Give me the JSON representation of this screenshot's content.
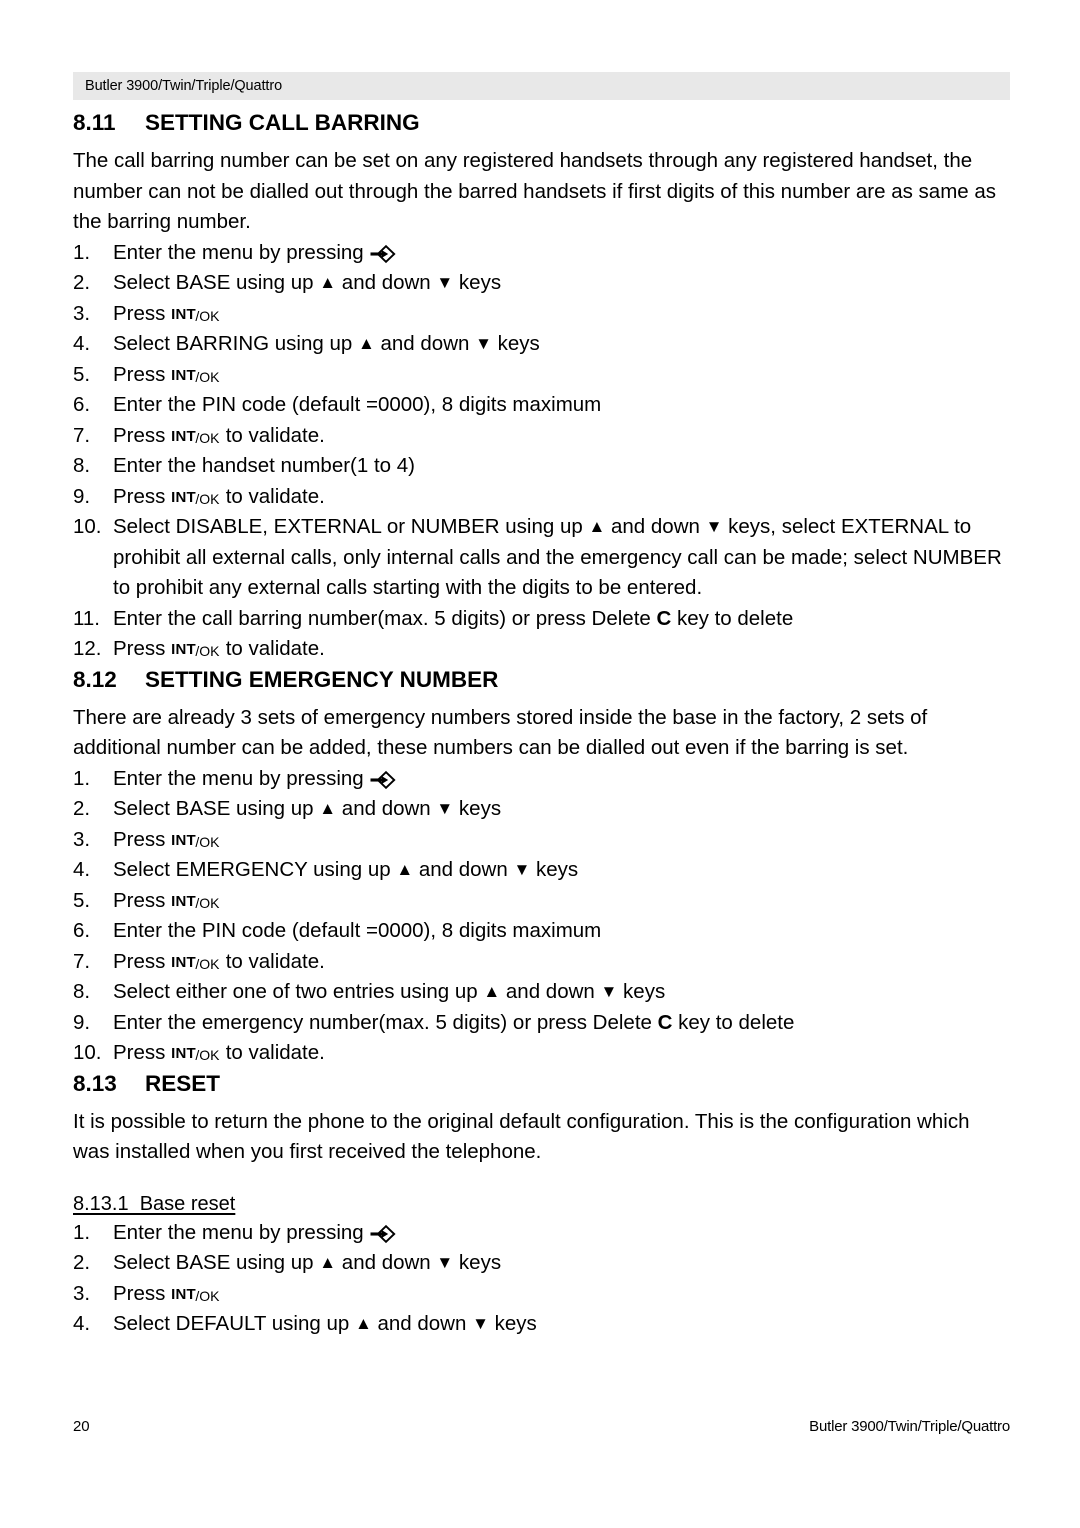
{
  "header": {
    "running_head": "Butler 3900/Twin/Triple/Quattro"
  },
  "icons": {
    "menu_key": "menu-arrow-diamond-icon",
    "up_key": "▲",
    "down_key": "▼",
    "int_ok_key_bold": "INT",
    "int_ok_key_small": "/OK",
    "delete_key": "C"
  },
  "sections": [
    {
      "number": "8.11",
      "title": "SETTING CALL BARRING",
      "paragraph": "The call barring number can be set on any registered handsets through any registered handset, the number can not be dialled out through the barred handsets if first digits of this number are as same as the barring number.",
      "steps": [
        {
          "mark": "1.",
          "pre": "Enter the menu by pressing ",
          "post": "",
          "glyph": "menu"
        },
        {
          "mark": "2.",
          "pre": "Select BASE using up ",
          "mid": " and down ",
          "post": " keys",
          "glyph": "updown"
        },
        {
          "mark": "3.",
          "pre": "Press ",
          "post": "",
          "glyph": "intok"
        },
        {
          "mark": "4.",
          "pre": "Select BARRING using up ",
          "mid": " and down ",
          "post": " keys",
          "glyph": "updown"
        },
        {
          "mark": "5.",
          "pre": "Press ",
          "post": "",
          "glyph": "intok"
        },
        {
          "mark": "6.",
          "pre": "Enter the PIN code (default =0000), 8 digits maximum",
          "post": "",
          "glyph": "none"
        },
        {
          "mark": "7.",
          "pre": "Press ",
          "post": " to validate.",
          "glyph": "intok"
        },
        {
          "mark": "8.",
          "pre": "Enter the handset number(1 to 4)",
          "post": "",
          "glyph": "none"
        },
        {
          "mark": "9.",
          "pre": "Press ",
          "post": " to validate.",
          "glyph": "intok"
        },
        {
          "mark": "10.",
          "pre": "Select DISABLE, EXTERNAL or NUMBER using up ",
          "mid": " and down ",
          "post": " keys, select EXTERNAL to prohibit all external calls, only internal calls and the emergency call can be made; select NUMBER to prohibit any external calls starting with the digits to be entered.",
          "glyph": "updown"
        },
        {
          "mark": "11.",
          "pre": "Enter the call barring number(max. 5 digits) or press Delete ",
          "post": " key to delete",
          "glyph": "ckey"
        },
        {
          "mark": "12.",
          "pre": "Press ",
          "post": " to validate.",
          "glyph": "intok"
        }
      ]
    },
    {
      "number": "8.12",
      "title": "SETTING EMERGENCY NUMBER",
      "paragraph": "There are already 3 sets of emergency numbers stored inside the base in the factory, 2 sets of additional number can be added, these numbers can be dialled out even if the barring is set.",
      "steps": [
        {
          "mark": "1.",
          "pre": "Enter the menu by pressing ",
          "post": "",
          "glyph": "menu"
        },
        {
          "mark": "2.",
          "pre": "Select BASE using up ",
          "mid": " and down ",
          "post": " keys",
          "glyph": "updown"
        },
        {
          "mark": "3.",
          "pre": "Press ",
          "post": "",
          "glyph": "intok"
        },
        {
          "mark": "4.",
          "pre": "Select EMERGENCY using up ",
          "mid": " and down ",
          "post": " keys",
          "glyph": "updown"
        },
        {
          "mark": "5.",
          "pre": "Press ",
          "post": "",
          "glyph": "intok"
        },
        {
          "mark": "6.",
          "pre": "Enter the PIN code (default =0000), 8 digits maximum",
          "post": "",
          "glyph": "none"
        },
        {
          "mark": "7.",
          "pre": "Press ",
          "post": " to validate.",
          "glyph": "intok"
        },
        {
          "mark": "8.",
          "pre": "Select either one of two entries using up ",
          "mid": " and down ",
          "post": " keys",
          "glyph": "updown"
        },
        {
          "mark": "9.",
          "pre": "Enter the emergency number(max. 5 digits) or  press Delete ",
          "post": " key to delete",
          "glyph": "ckey"
        },
        {
          "mark": "10.",
          "pre": "Press ",
          "post": " to validate.",
          "glyph": "intok"
        }
      ]
    },
    {
      "number": "8.13",
      "title": "RESET",
      "paragraph": "It is possible to return the phone to the original default configuration. This is the configuration which was installed when you first received the telephone.",
      "subsection": "8.13.1  Base reset",
      "steps": [
        {
          "mark": "1.",
          "pre": "Enter the menu by pressing ",
          "post": "",
          "glyph": "menu"
        },
        {
          "mark": "2.",
          "pre": "Select BASE using up ",
          "mid": " and down ",
          "post": " keys",
          "glyph": "updown"
        },
        {
          "mark": "3.",
          "pre": "Press ",
          "post": "",
          "glyph": "intok"
        },
        {
          "mark": "4.",
          "pre": "Select DEFAULT using up ",
          "mid": " and down ",
          "post": " keys",
          "glyph": "updown"
        }
      ]
    }
  ],
  "footer": {
    "page_number": "20",
    "running_foot": "Butler 3900/Twin/Triple/Quattro"
  }
}
